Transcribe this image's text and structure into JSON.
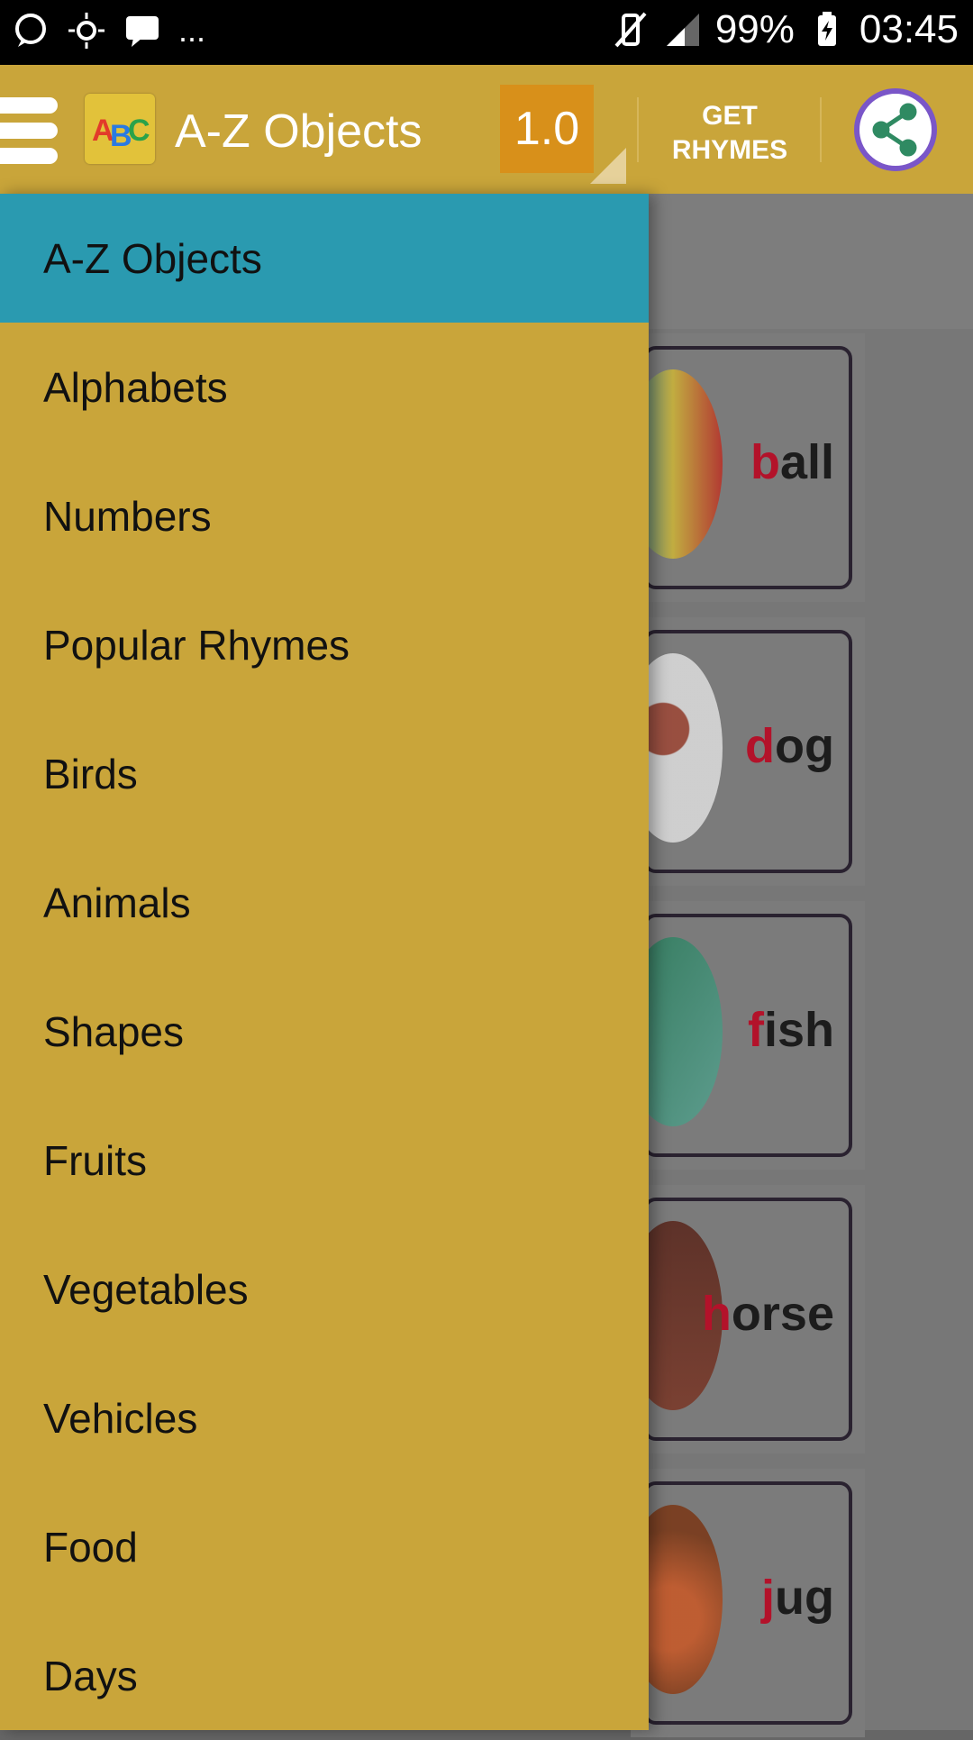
{
  "status_bar": {
    "left_icons": [
      "chat-bubble-icon",
      "sun-icon",
      "message-icon",
      "more-dots-icon"
    ],
    "left_more": "...",
    "battery": "99%",
    "time": "03:45"
  },
  "app_bar": {
    "title": "A-Z Objects",
    "version": "1.0",
    "get_rhymes": "GET RHYMES"
  },
  "drawer": {
    "items": [
      {
        "label": "A-Z Objects"
      },
      {
        "label": "Alphabets"
      },
      {
        "label": "Numbers"
      },
      {
        "label": "Popular Rhymes"
      },
      {
        "label": "Birds"
      },
      {
        "label": "Animals"
      },
      {
        "label": "Shapes"
      },
      {
        "label": "Fruits"
      },
      {
        "label": "Vegetables"
      },
      {
        "label": "Vehicles"
      },
      {
        "label": "Food"
      },
      {
        "label": "Days"
      }
    ]
  },
  "cards": [
    {
      "first": "b",
      "rest": "all"
    },
    {
      "first": "d",
      "rest": "og"
    },
    {
      "first": "f",
      "rest": "ish"
    },
    {
      "first": "h",
      "rest": "orse"
    },
    {
      "first": "j",
      "rest": "ug"
    }
  ],
  "colors": {
    "appbar": "#c9a53a",
    "drawer_active": "#2a9ab0",
    "version_bg": "#d8901a",
    "share_ring": "#7a56c8",
    "share_icon": "#2f8a62"
  }
}
